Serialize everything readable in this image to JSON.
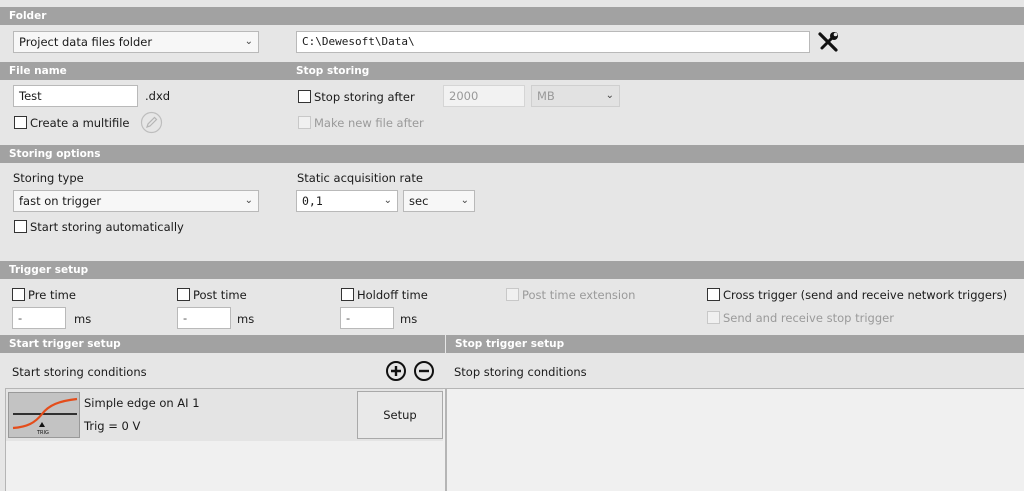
{
  "folder": {
    "header": "Folder",
    "location_select": "Project data files folder",
    "path": "C:\\Dewesoft\\Data\\"
  },
  "file_name": {
    "header": "File name",
    "name_value": "Test",
    "extension": ".dxd",
    "multifile_label": "Create a multifile"
  },
  "stop_storing": {
    "header": "Stop storing",
    "stop_after_label": "Stop storing after",
    "stop_after_value": "2000",
    "unit_select": "MB",
    "new_file_label": "Make new file after"
  },
  "storing_options": {
    "header": "Storing options",
    "type_label": "Storing type",
    "type_value": "fast on trigger",
    "rate_label": "Static acquisition rate",
    "rate_value": "0,1",
    "rate_unit": "sec",
    "auto_start_label": "Start storing automatically"
  },
  "trigger_setup": {
    "header": "Trigger setup",
    "pre_time_label": "Pre time",
    "pre_time_value": "-",
    "post_time_label": "Post time",
    "post_time_value": "-",
    "holdoff_label": "Holdoff time",
    "holdoff_value": "-",
    "unit": "ms",
    "post_ext_label": "Post time extension",
    "cross_trigger_label": "Cross trigger (send and receive network triggers)",
    "stop_trigger_label": "Send and receive stop trigger"
  },
  "start_trigger": {
    "header": "Start trigger setup",
    "conditions_label": "Start storing conditions",
    "item_title": "Simple edge on AI 1",
    "item_detail": "Trig = 0 V",
    "item_button": "Setup",
    "thumb_label": "TRIG"
  },
  "stop_trigger": {
    "header": "Stop trigger setup",
    "conditions_label": "Stop storing conditions"
  }
}
